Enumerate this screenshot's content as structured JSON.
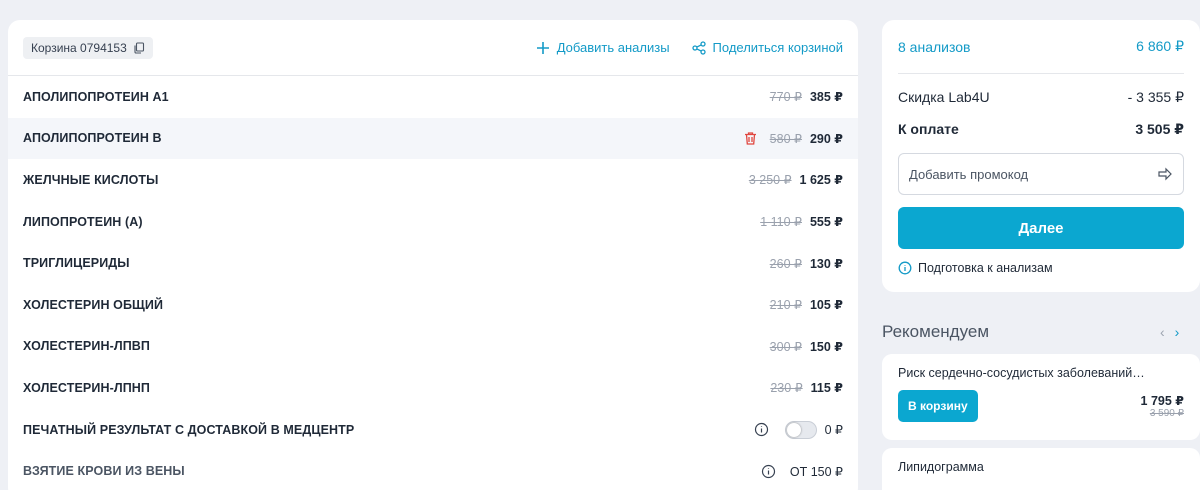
{
  "cart": {
    "id_label": "Корзина 0794153",
    "add_label": "Добавить анализы",
    "share_label": "Поделиться корзиной",
    "items": [
      {
        "name": "АПОЛИПОПРОТЕИН А1",
        "old": "770 ₽",
        "new": "385 ₽"
      },
      {
        "name": "АПОЛИПОПРОТЕИН В",
        "old": "580 ₽",
        "new": "290 ₽"
      },
      {
        "name": "ЖЕЛЧНЫЕ КИСЛОТЫ",
        "old": "3 250 ₽",
        "new": "1 625 ₽"
      },
      {
        "name": "ЛИПОПРОТЕИН (А)",
        "old": "1 110 ₽",
        "new": "555 ₽"
      },
      {
        "name": "ТРИГЛИЦЕРИДЫ",
        "old": "260 ₽",
        "new": "130 ₽"
      },
      {
        "name": "ХОЛЕСТЕРИН ОБЩИЙ",
        "old": "210 ₽",
        "new": "105 ₽"
      },
      {
        "name": "ХОЛЕСТЕРИН-ЛПВП",
        "old": "300 ₽",
        "new": "150 ₽"
      },
      {
        "name": "ХОЛЕСТЕРИН-ЛПНП",
        "old": "230 ₽",
        "new": "115 ₽"
      }
    ],
    "print_result": {
      "name": "ПЕЧАТНЫЙ РЕЗУЛЬТАТ С ДОСТАВКОЙ В МЕДЦЕНТР",
      "price": "0 ₽",
      "toggle_on": false
    },
    "blood_draw": {
      "name": "ВЗЯТИЕ КРОВИ ИЗ ВЕНЫ",
      "price": "ОТ 150 ₽"
    }
  },
  "summary": {
    "count_label": "8 анализов",
    "total": "6 860 ₽",
    "discount_label": "Скидка Lab4U",
    "discount": "- 3 355 ₽",
    "pay_label": "К оплате",
    "pay": "3 505 ₽",
    "promo_placeholder": "Добавить промокод",
    "next_label": "Далее",
    "prep_label": "Подготовка к анализам"
  },
  "recommend": {
    "title": "Рекомендуем",
    "cards": [
      {
        "name": "Риск сердечно-сосудистых заболеваний…",
        "button": "В корзину",
        "price": "1 795 ₽",
        "old": "3 590 ₽"
      },
      {
        "name": "Липидограмма"
      }
    ]
  },
  "colors": {
    "accent": "#139ac7",
    "button": "#0ba7d0",
    "trash": "#e0463f"
  }
}
